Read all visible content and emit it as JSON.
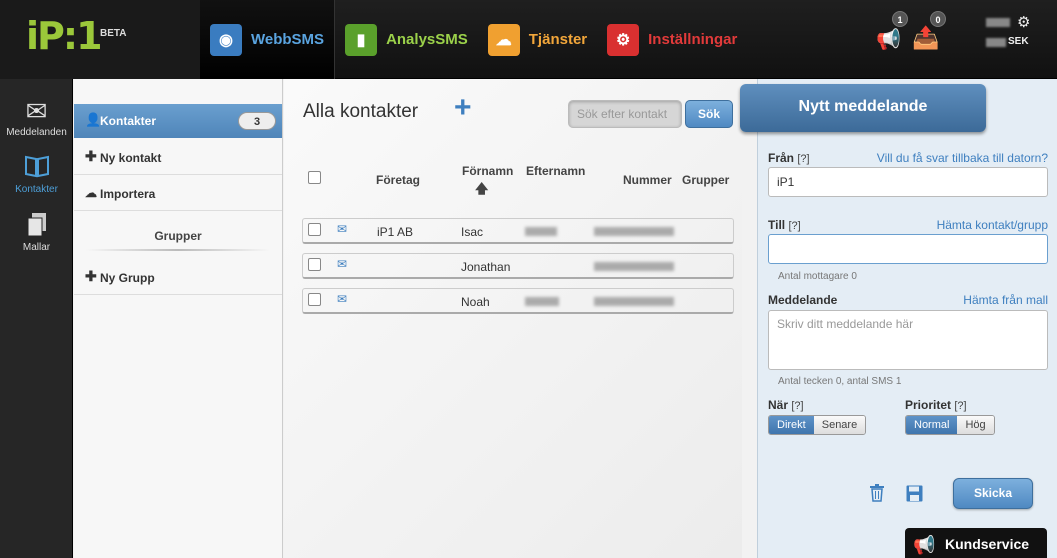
{
  "logo": {
    "text": "iP:1",
    "beta": "BETA"
  },
  "topnav": [
    {
      "label": "WebbSMS",
      "icon": "globe-icon",
      "color": "#5aa4e0",
      "bg": "#3a7cc0",
      "glyph": "◉"
    },
    {
      "label": "AnalysSMS",
      "icon": "bar-chart-icon",
      "color": "#9bd14a",
      "bg": "#5aa02b",
      "glyph": "▮"
    },
    {
      "label": "Tjänster",
      "icon": "cloud-icon",
      "color": "#f2a63a",
      "bg": "#f0a030",
      "glyph": "☁"
    },
    {
      "label": "Inställningar",
      "icon": "gears-icon",
      "color": "#e23a3a",
      "bg": "#d93030",
      "glyph": "⚙"
    }
  ],
  "top_right": {
    "notifications_count": "1",
    "outbox_count": "0",
    "balance_suffix": "SEK"
  },
  "iconbar": [
    {
      "label": "Meddelanden",
      "icon": "envelope-icon",
      "glyph": "✉"
    },
    {
      "label": "Kontakter",
      "icon": "book-icon",
      "glyph": "📖"
    },
    {
      "label": "Mallar",
      "icon": "documents-icon",
      "glyph": "🗍"
    }
  ],
  "sidebar": {
    "contacts_label": "Kontakter",
    "contacts_count": "3",
    "new_contact": "Ny kontakt",
    "import": "Importera",
    "groups_title": "Grupper",
    "new_group": "Ny Grupp"
  },
  "main": {
    "title": "Alla kontakter",
    "search_placeholder": "Sök efter kontakt",
    "search_button": "Sök",
    "columns": {
      "company": "Företag",
      "firstname": "Förnamn",
      "lastname": "Efternamn",
      "number": "Nummer",
      "groups": "Grupper"
    },
    "rows": [
      {
        "company": "iP1 AB",
        "firstname": "Isac"
      },
      {
        "company": "",
        "firstname": "Jonathan"
      },
      {
        "company": "",
        "firstname": "Noah"
      }
    ]
  },
  "message": {
    "tab_title": "Nytt meddelande",
    "from_label": "Från",
    "help": "[?]",
    "reply_link": "Vill du få svar tillbaka till datorn?",
    "from_value": "iP1",
    "to_label": "Till",
    "fetch_contact_link": "Hämta kontakt/grupp",
    "recipients_hint": "Antal mottagare 0",
    "message_label": "Meddelande",
    "fetch_template_link": "Hämta från mall",
    "message_placeholder": "Skriv ditt meddelande här",
    "chars_hint": "Antal tecken 0, antal SMS 1",
    "when_label": "När",
    "when_on": "Direkt",
    "when_off": "Senare",
    "priority_label": "Prioritet",
    "priority_on": "Normal",
    "priority_off": "Hög",
    "send_button": "Skicka"
  },
  "support": "Kundservice"
}
